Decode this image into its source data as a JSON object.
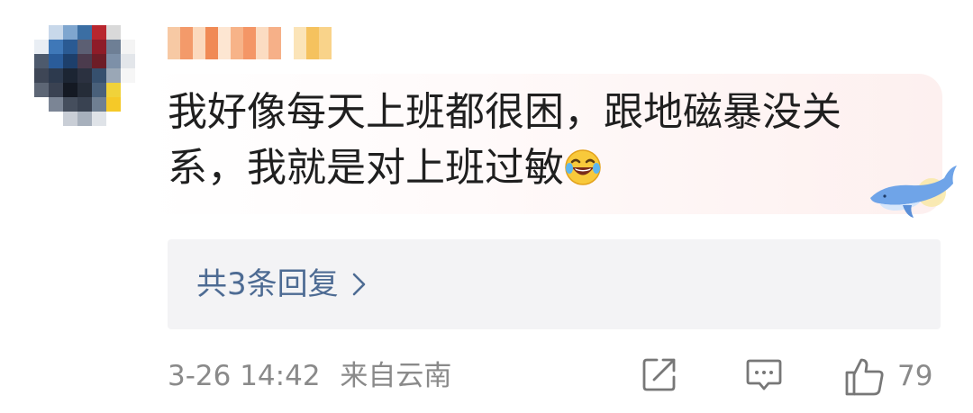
{
  "comment": {
    "text_line1": "我好像每天上班都很困，跟地磁暴没关",
    "text_line2": "系，我就是对上班过敏",
    "emoji": "laugh-cry-emoji"
  },
  "replies": {
    "label": "共3条回复"
  },
  "meta": {
    "time": "3-26 14:42",
    "location": "来自云南"
  },
  "actions": {
    "like_count": "79"
  },
  "colors": {
    "link": "#4d6b93",
    "meta": "#8a8a8a",
    "text": "#1f1f1f",
    "reply_bg": "#f3f3f5"
  }
}
